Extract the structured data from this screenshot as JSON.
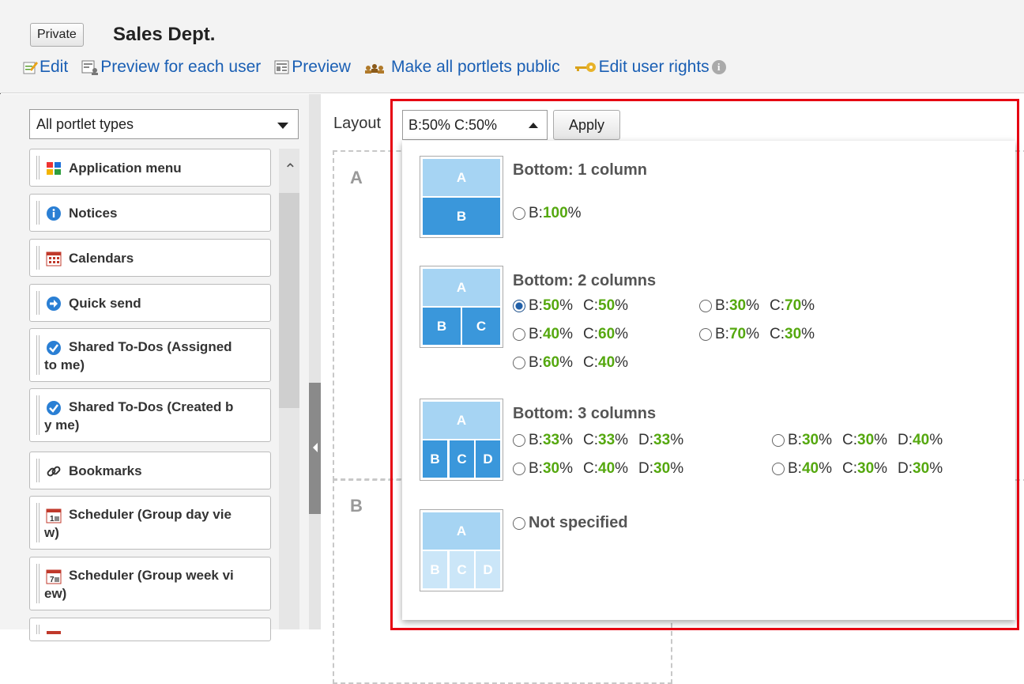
{
  "header": {
    "private_label": "Private",
    "space_title": "Sales Dept.",
    "actions": [
      {
        "label": "Edit",
        "icon": "edit-icon"
      },
      {
        "label": "Preview for each user",
        "icon": "preview-user-icon"
      },
      {
        "label": "Preview",
        "icon": "preview-icon"
      },
      {
        "label": "Make all portlets public",
        "icon": "make-public-icon"
      },
      {
        "label": "Edit user rights",
        "icon": "key-icon"
      }
    ],
    "info_icon": "info-icon"
  },
  "sidebar": {
    "filter": "All portlet types",
    "portlets": [
      {
        "line1": "Application menu",
        "icon": "app-menu-icon"
      },
      {
        "line1": "Notices",
        "icon": "info-icon"
      },
      {
        "line1": "Calendars",
        "icon": "calendar-icon"
      },
      {
        "line1": "Quick send",
        "icon": "arrow-circle-icon"
      },
      {
        "line1": "Shared To-Dos (Assigned",
        "line2": "to me)",
        "icon": "check-circle-icon"
      },
      {
        "line1": "Shared To-Dos (Created b",
        "line2": "y me)",
        "icon": "check-circle-icon"
      },
      {
        "line1": "Bookmarks",
        "icon": "link-icon"
      },
      {
        "line1": "Scheduler (Group day vie",
        "line2": "w)",
        "icon": "day-calendar-icon"
      },
      {
        "line1": "Scheduler (Group week vi",
        "line2": "ew)",
        "icon": "week-calendar-icon"
      }
    ]
  },
  "main": {
    "layout_label": "Layout",
    "layout_value": "B:50% C:50%",
    "apply_label": "Apply",
    "zone_a": "A",
    "zone_b": "B"
  },
  "panel": {
    "thumbs": {
      "a": "A",
      "b": "B",
      "c": "C",
      "d": "D"
    },
    "group1": {
      "title": "Bottom: 1 column",
      "options": [
        {
          "parts": [
            {
              "k": "B:",
              "v": "100"
            }
          ],
          "selected": false
        }
      ]
    },
    "group2": {
      "title": "Bottom: 2 columns",
      "options": [
        {
          "parts": [
            {
              "k": "B:",
              "v": "50"
            },
            {
              "k": "C:",
              "v": "50"
            }
          ],
          "selected": true
        },
        {
          "parts": [
            {
              "k": "B:",
              "v": "30"
            },
            {
              "k": "C:",
              "v": "70"
            }
          ],
          "selected": false
        },
        {
          "parts": [
            {
              "k": "B:",
              "v": "40"
            },
            {
              "k": "C:",
              "v": "60"
            }
          ],
          "selected": false
        },
        {
          "parts": [
            {
              "k": "B:",
              "v": "70"
            },
            {
              "k": "C:",
              "v": "30"
            }
          ],
          "selected": false
        },
        {
          "parts": [
            {
              "k": "B:",
              "v": "60"
            },
            {
              "k": "C:",
              "v": "40"
            }
          ],
          "selected": false
        }
      ]
    },
    "group3": {
      "title": "Bottom: 3 columns",
      "options": [
        {
          "parts": [
            {
              "k": "B:",
              "v": "33"
            },
            {
              "k": "C:",
              "v": "33"
            },
            {
              "k": "D:",
              "v": "33"
            }
          ],
          "selected": false
        },
        {
          "parts": [
            {
              "k": "B:",
              "v": "30"
            },
            {
              "k": "C:",
              "v": "30"
            },
            {
              "k": "D:",
              "v": "40"
            }
          ],
          "selected": false
        },
        {
          "parts": [
            {
              "k": "B:",
              "v": "30"
            },
            {
              "k": "C:",
              "v": "40"
            },
            {
              "k": "D:",
              "v": "30"
            }
          ],
          "selected": false
        },
        {
          "parts": [
            {
              "k": "B:",
              "v": "40"
            },
            {
              "k": "C:",
              "v": "30"
            },
            {
              "k": "D:",
              "v": "30"
            }
          ],
          "selected": false
        }
      ]
    },
    "none_label": "Not specified",
    "percent": "%",
    "colors": {
      "value_green": "#55a80f",
      "highlight_red": "#e60012",
      "thumb_dark": "#3a97db",
      "thumb_light": "#a6d4f3"
    }
  }
}
